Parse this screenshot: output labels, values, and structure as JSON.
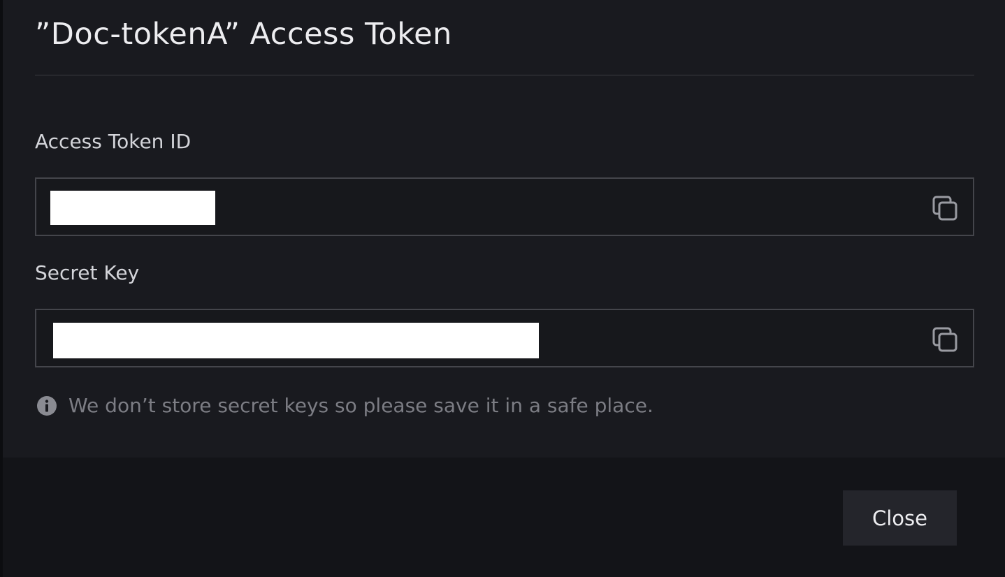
{
  "modal": {
    "title": "”Doc-tokenA” Access Token",
    "access_token_field": {
      "label": "Access Token ID",
      "copy_icon": "copy-icon",
      "value_redacted": true
    },
    "secret_key_field": {
      "label": "Secret Key",
      "copy_icon": "copy-icon",
      "value_redacted": true
    },
    "notice": {
      "icon": "info-icon",
      "text": "We don’t store secret keys so please save it in a safe place."
    },
    "footer": {
      "close_label": "Close"
    }
  },
  "colors": {
    "background": "#111216",
    "modal_body": "#191a1f",
    "modal_footer": "#131418",
    "field_border": "#44454b",
    "text_primary": "#ededf0",
    "text_muted": "#7c7d84",
    "button_bg": "#24252b"
  }
}
